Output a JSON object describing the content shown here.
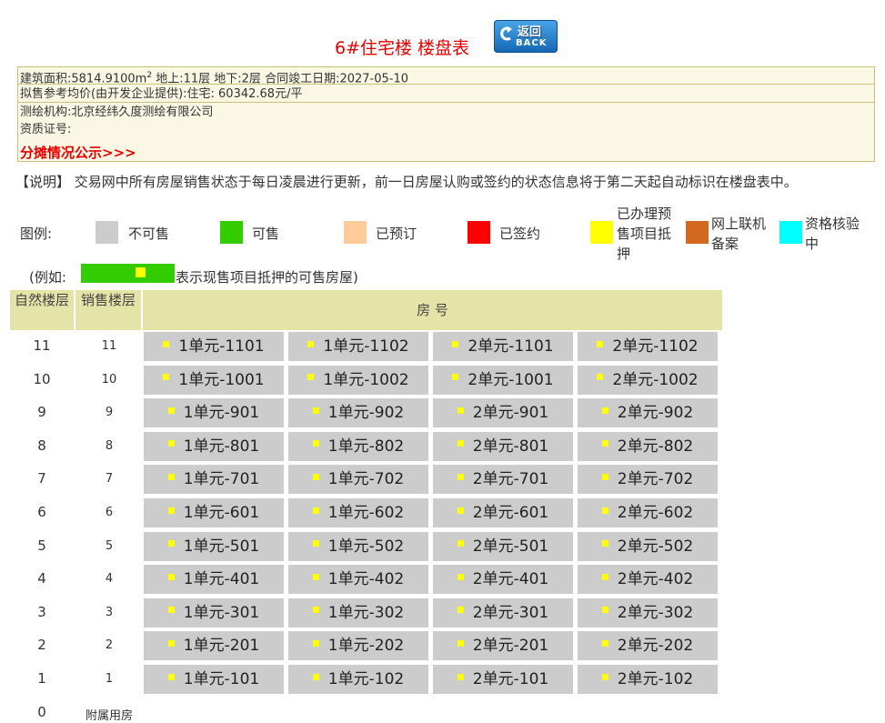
{
  "header": {
    "title": "6#住宅楼  楼盘表",
    "back_label_top": "返回",
    "back_label_bottom": "BACK"
  },
  "info": {
    "line1_pre": "建筑面积:5814.9100m",
    "line1_sup": "2",
    "line1_post": "  地上:11层  地下:2层  合同竣工日期:2027-05-10",
    "line2": "拟售参考均价(由开发企业提供):住宅:  60342.68元/平",
    "line3": "测绘机构:北京经纬久度测绘有限公司",
    "line4": "资质证号:",
    "share_link": "分摊情况公示>>>"
  },
  "note": "【说明】 交易网中所有房屋销售状态于每日凌晨进行更新，前一日房屋认购或签约的状态信息将于第二天起自动标识在楼盘表中。",
  "legend": {
    "label": "图例:",
    "items": [
      {
        "label": "不可售",
        "color": "#cccccc"
      },
      {
        "label": "可售",
        "color": "#33cc00"
      },
      {
        "label": "已预订",
        "color": "#ffcc99"
      },
      {
        "label": "已签约",
        "color": "#ff0000"
      },
      {
        "label": "已办理预售项目抵押",
        "color": "#ffff00"
      },
      {
        "label": "网上联机备案",
        "color": "#d2691e"
      },
      {
        "label": "资格核验中",
        "color": "#00ffff"
      }
    ]
  },
  "example": {
    "prefix": "(例如:",
    "suffix": "表示现售项目抵押的可售房屋)"
  },
  "table": {
    "header_floor": "自然楼层",
    "header_sale": "销售楼层",
    "header_room": "房 号",
    "rows": [
      {
        "floor": "11",
        "sale": "11",
        "rooms": [
          "1单元-1101",
          "1单元-1102",
          "2单元-1101",
          "2单元-1102"
        ]
      },
      {
        "floor": "10",
        "sale": "10",
        "rooms": [
          "1单元-1001",
          "1单元-1002",
          "2单元-1001",
          "2单元-1002"
        ]
      },
      {
        "floor": "9",
        "sale": "9",
        "rooms": [
          "1单元-901",
          "1单元-902",
          "2单元-901",
          "2单元-902"
        ]
      },
      {
        "floor": "8",
        "sale": "8",
        "rooms": [
          "1单元-801",
          "1单元-802",
          "2单元-801",
          "2单元-802"
        ]
      },
      {
        "floor": "7",
        "sale": "7",
        "rooms": [
          "1单元-701",
          "1单元-702",
          "2单元-701",
          "2单元-702"
        ]
      },
      {
        "floor": "6",
        "sale": "6",
        "rooms": [
          "1单元-601",
          "1单元-602",
          "2单元-601",
          "2单元-602"
        ]
      },
      {
        "floor": "5",
        "sale": "5",
        "rooms": [
          "1单元-501",
          "1单元-502",
          "2单元-501",
          "2单元-502"
        ]
      },
      {
        "floor": "4",
        "sale": "4",
        "rooms": [
          "1单元-401",
          "1单元-402",
          "2单元-401",
          "2单元-402"
        ]
      },
      {
        "floor": "3",
        "sale": "3",
        "rooms": [
          "1单元-301",
          "1单元-302",
          "2单元-301",
          "2单元-302"
        ]
      },
      {
        "floor": "2",
        "sale": "2",
        "rooms": [
          "1单元-201",
          "1单元-202",
          "2单元-201",
          "2单元-202"
        ]
      },
      {
        "floor": "1",
        "sale": "1",
        "rooms": [
          "1单元-101",
          "1单元-102",
          "2单元-101",
          "2单元-102"
        ]
      },
      {
        "floor": "0",
        "sale": "附属用房",
        "rooms": []
      }
    ]
  }
}
